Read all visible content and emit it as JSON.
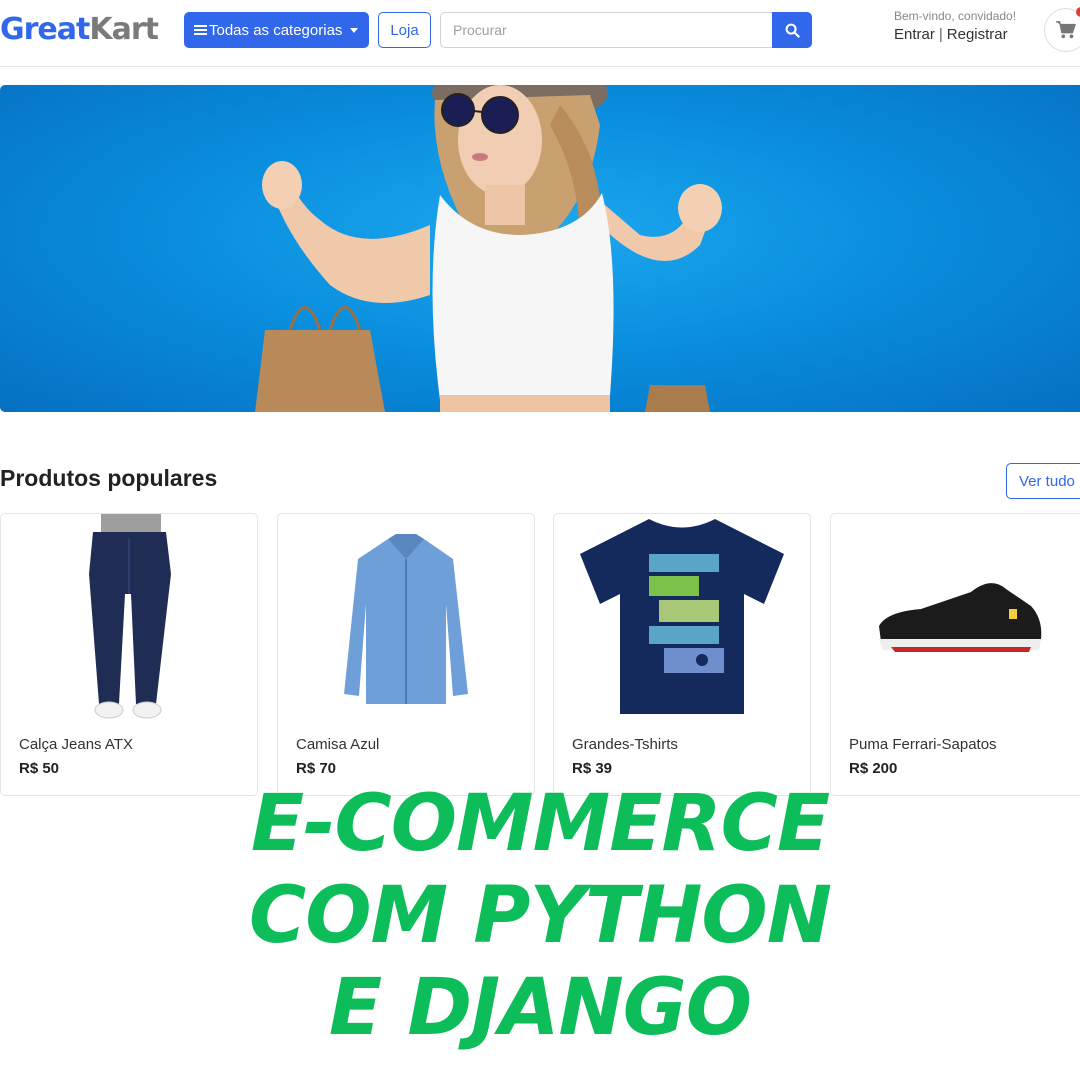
{
  "header": {
    "logo_primary": "Great",
    "logo_secondary": "Kart",
    "categories_label": "Todas as categorias",
    "store_label": "Loja",
    "search_placeholder": "Procurar",
    "welcome": "Bem-vindo, convidado!",
    "login": "Entrar",
    "register": "Registrar",
    "icons": [
      "bars-icon",
      "caret-down-icon",
      "search-icon",
      "cart-icon"
    ]
  },
  "banner": {
    "image": "banner-woman-shopping-bags"
  },
  "popular": {
    "title": "Produtos populares",
    "view_all": "Ver tudo",
    "products": [
      {
        "name": "Calça Jeans ATX",
        "price": "R$ 50",
        "image": "jeans"
      },
      {
        "name": "Camisa Azul",
        "price": "R$ 70",
        "image": "blue-shirt"
      },
      {
        "name": "Grandes-Tshirts",
        "price": "R$ 39",
        "image": "navy-tshirt"
      },
      {
        "name": "Puma Ferrari-Sapatos",
        "price": "R$ 200",
        "image": "sneaker"
      }
    ]
  },
  "overlay": {
    "line1": "E-COMMERCE",
    "line2": "COM PYTHON",
    "line3": "E DJANGO"
  },
  "colors": {
    "primary": "#3167eb",
    "banner": "#0a8fde",
    "headline": "#0dbd5a",
    "badge": "#e53935"
  }
}
